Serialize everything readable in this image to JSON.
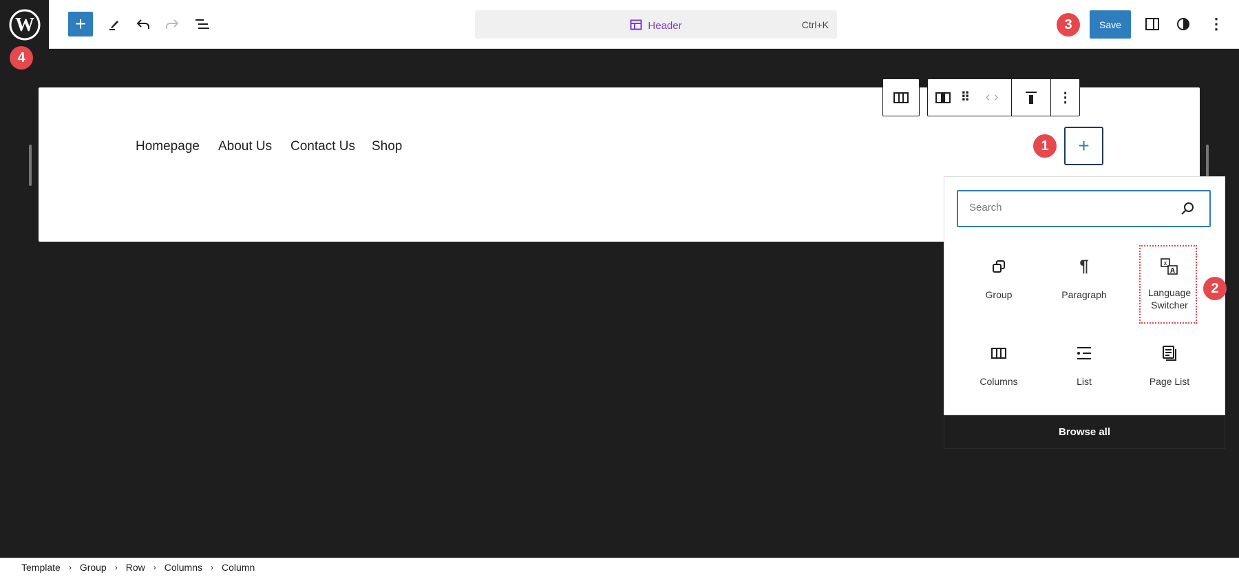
{
  "topbar": {
    "command_title": "Header",
    "shortcut": "Ctrl+K",
    "save_label": "Save"
  },
  "badges": [
    "1",
    "2",
    "3",
    "4"
  ],
  "nav_items": [
    "Homepage",
    "About Us",
    "Contact Us",
    "Shop"
  ],
  "inserter": {
    "search_placeholder": "Search",
    "blocks": [
      {
        "label": "Group",
        "icon": "group-icon"
      },
      {
        "label": "Paragraph",
        "icon": "paragraph-icon"
      },
      {
        "label": "Language Switcher",
        "icon": "translate-icon"
      },
      {
        "label": "Columns",
        "icon": "columns-icon"
      },
      {
        "label": "List",
        "icon": "list-icon"
      },
      {
        "label": "Page List",
        "icon": "page-list-icon"
      }
    ],
    "browse_all": "Browse all"
  },
  "breadcrumb": [
    "Template",
    "Group",
    "Row",
    "Columns",
    "Column"
  ],
  "colors": {
    "accent": "#2e7dbd",
    "badge": "#e5484d",
    "title": "#7a3fd1"
  }
}
